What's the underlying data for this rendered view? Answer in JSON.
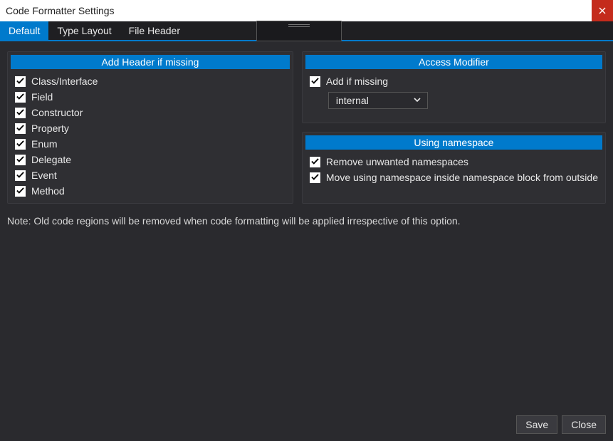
{
  "window": {
    "title": "Code Formatter Settings"
  },
  "tabs": {
    "default": "Default",
    "type_layout": "Type Layout",
    "file_header": "File Header",
    "active": "default"
  },
  "left_panel": {
    "header": "Add Header if missing",
    "items": [
      {
        "label": "Class/Interface",
        "checked": true
      },
      {
        "label": "Field",
        "checked": true
      },
      {
        "label": "Constructor",
        "checked": true
      },
      {
        "label": "Property",
        "checked": true
      },
      {
        "label": "Enum",
        "checked": true
      },
      {
        "label": "Delegate",
        "checked": true
      },
      {
        "label": "Event",
        "checked": true
      },
      {
        "label": "Method",
        "checked": true
      }
    ]
  },
  "access_modifier": {
    "header": "Access Modifier",
    "add_if_missing": {
      "label": "Add if missing",
      "checked": true
    },
    "selected": "internal"
  },
  "using_namespace": {
    "header": "Using namespace",
    "remove_unwanted": {
      "label": "Remove unwanted namespaces",
      "checked": true
    },
    "move_inside": {
      "label": "Move using namespace inside namespace block from outside",
      "checked": true
    }
  },
  "note": "Note: Old code regions will be removed when code formatting will be applied irrespective of this option.",
  "footer": {
    "save": "Save",
    "close": "Close"
  }
}
